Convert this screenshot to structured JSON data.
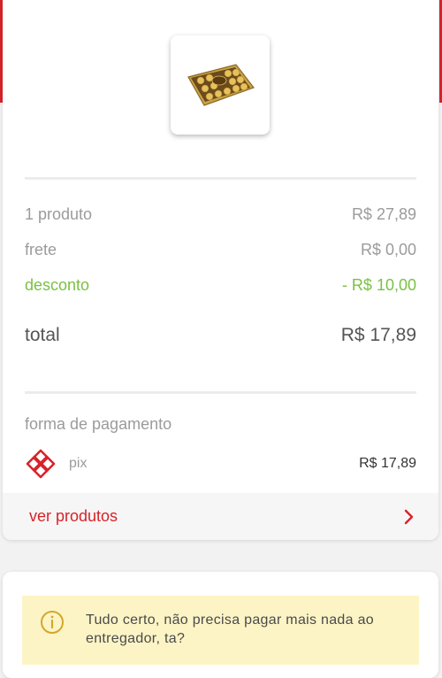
{
  "product": {
    "image_icon": "chocolate-box-image"
  },
  "summary": {
    "items_label": "1 produto",
    "items_value": "R$ 27,89",
    "shipping_label": "frete",
    "shipping_value": "R$ 0,00",
    "discount_label": "desconto",
    "discount_value": "- R$ 10,00",
    "total_label": "total",
    "total_value": "R$ 17,89"
  },
  "payment": {
    "title": "forma de pagamento",
    "method_icon": "pix-icon",
    "method": "pix",
    "amount": "R$ 17,89"
  },
  "footer": {
    "link_label": "ver produtos",
    "chevron_icon": "chevron-right-icon"
  },
  "notice": {
    "icon": "info-icon",
    "text": "Tudo certo, não precisa pagar mais nada ao entregador, ta?"
  },
  "colors": {
    "brand_red": "#d8232a",
    "discount_green": "#7ac143",
    "notice_bg": "#fdf4c6",
    "info_gold": "#d4a72c"
  }
}
